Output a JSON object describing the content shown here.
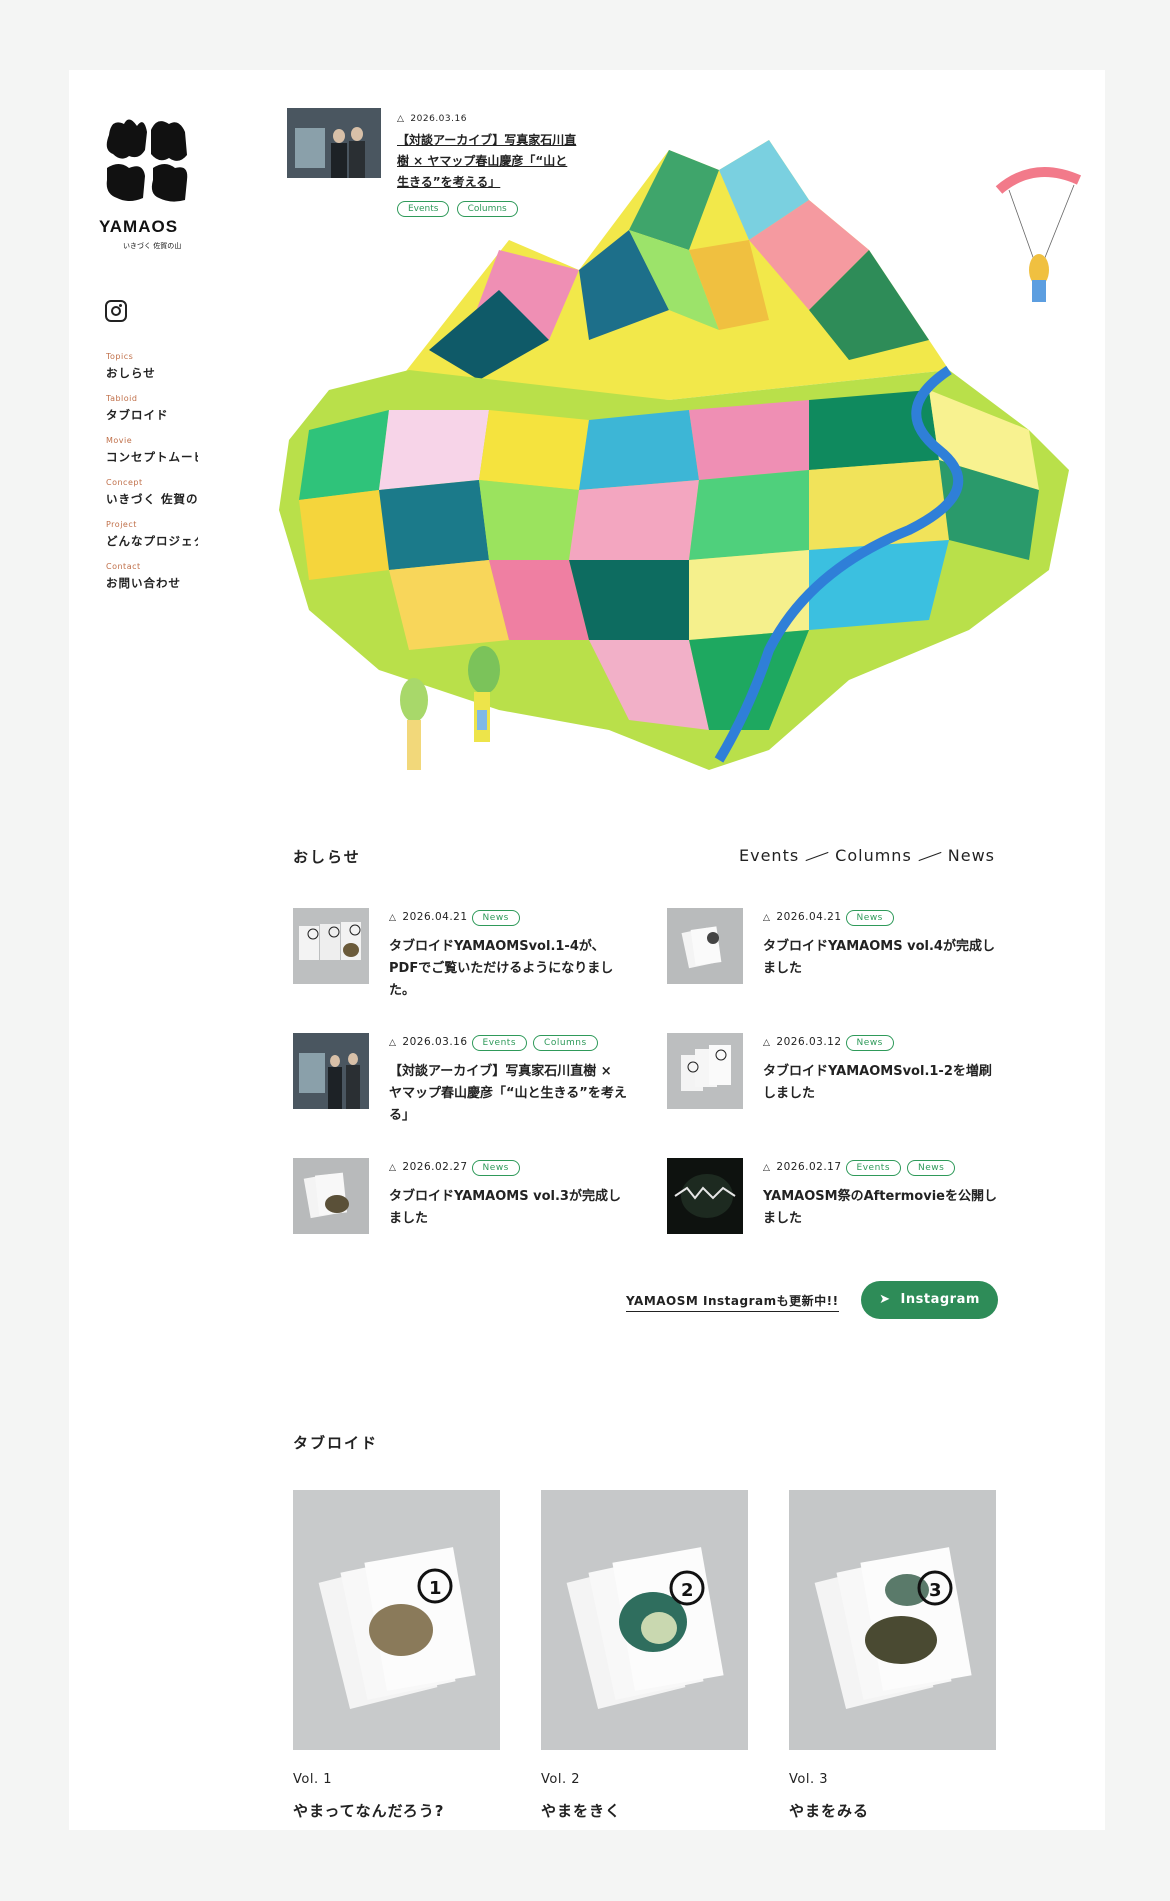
{
  "brand": {
    "name": "YAMAOS",
    "tagline": "いきづく 佐賀の山"
  },
  "sidebar": {
    "items": [
      {
        "en": "Topics",
        "jp": "おしらせ"
      },
      {
        "en": "Tabloid",
        "jp": "タブロイド"
      },
      {
        "en": "Movie",
        "jp": "コンセプトムービー"
      },
      {
        "en": "Concept",
        "jp": "いきづく 佐賀の山"
      },
      {
        "en": "Project",
        "jp": "どんなプロジェクト"
      },
      {
        "en": "Contact",
        "jp": "お問い合わせ"
      }
    ]
  },
  "feature": {
    "date": "2026.03.16",
    "title": "【対談アーカイブ】写真家石川直樹 × ヤマップ春山慶彦「“山と生きる”を考える」",
    "tags": [
      "Events",
      "Columns"
    ]
  },
  "news": {
    "title": "おしらせ",
    "categories": [
      "Events",
      "Columns",
      "News"
    ],
    "items": [
      {
        "date": "2026.04.21",
        "tags": [
          "News"
        ],
        "title": "タブロイドYAMAOMSvol.1-4が、PDFでご覧いただけるようになりました。"
      },
      {
        "date": "2026.04.21",
        "tags": [
          "News"
        ],
        "title": "タブロイドYAMAOMS vol.4が完成しました"
      },
      {
        "date": "2026.03.16",
        "tags": [
          "Events",
          "Columns"
        ],
        "title": "【対談アーカイブ】写真家石川直樹 × ヤマップ春山慶彦「“山と生きる”を考える」"
      },
      {
        "date": "2026.03.12",
        "tags": [
          "News"
        ],
        "title": "タブロイドYAMAOMSvol.1-2を増刷しました"
      },
      {
        "date": "2026.02.27",
        "tags": [
          "News"
        ],
        "title": "タブロイドYAMAOMS vol.3が完成しました"
      },
      {
        "date": "2026.02.17",
        "tags": [
          "Events",
          "News"
        ],
        "title": "YAMAOSM祭のAftermovieを公開しました"
      }
    ],
    "instagram_text": "YAMAOSM Instagramも更新中!!",
    "instagram_button": "Instagram"
  },
  "tabloid": {
    "title": "タブロイド",
    "items": [
      {
        "vol": "Vol. 1",
        "name": "やまってなんだろう?",
        "num": "1"
      },
      {
        "vol": "Vol. 2",
        "name": "やまをきく",
        "num": "2"
      },
      {
        "vol": "Vol. 3",
        "name": "やまをみる",
        "num": "3"
      }
    ]
  },
  "colors": {
    "accent": "#2e8c58",
    "nav_en": "#c0704a"
  }
}
